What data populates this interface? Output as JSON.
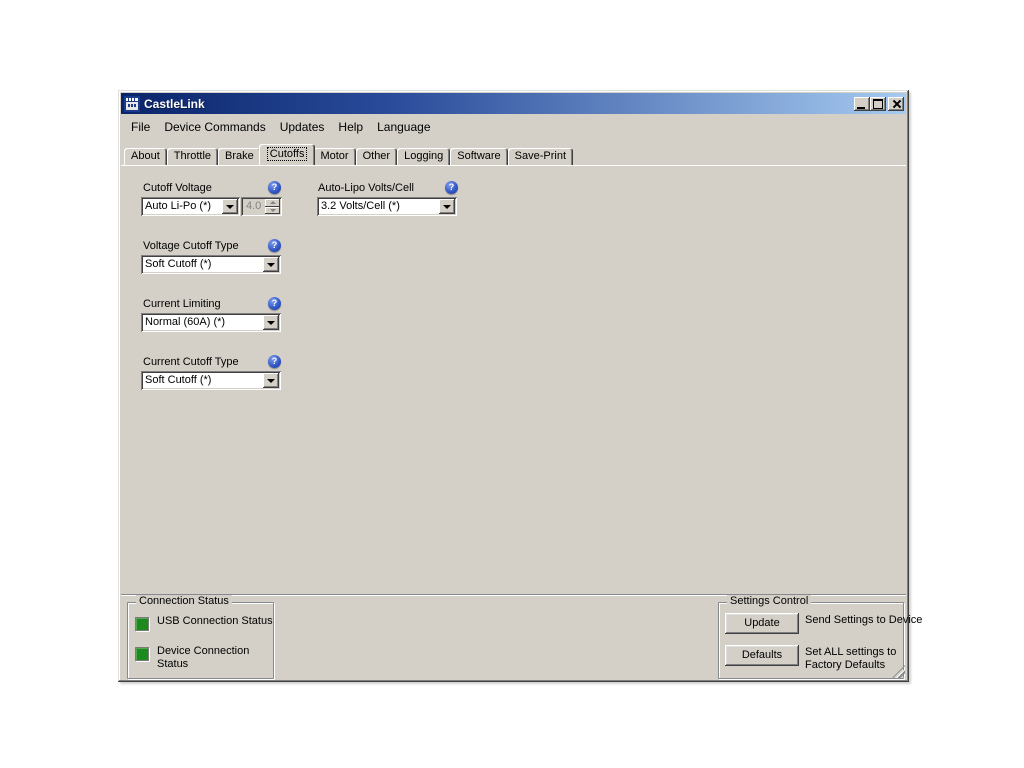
{
  "window": {
    "title": "CastleLink"
  },
  "menu": {
    "items": [
      "File",
      "Device Commands",
      "Updates",
      "Help",
      "Language"
    ]
  },
  "tabs": {
    "items": [
      "About",
      "Throttle",
      "Brake",
      "Cutoffs",
      "Motor",
      "Other",
      "Logging",
      "Software",
      "Save-Print"
    ],
    "active": "Cutoffs"
  },
  "form": {
    "help_icon_glyph": "?",
    "cutoff_voltage": {
      "label": "Cutoff Voltage",
      "selected": "Auto Li-Po (*)",
      "spinner_value": "4.0"
    },
    "auto_lipo_volts": {
      "label": "Auto-Lipo Volts/Cell",
      "selected": "3.2 Volts/Cell (*)"
    },
    "voltage_cutoff_type": {
      "label": "Voltage Cutoff Type",
      "selected": "Soft Cutoff (*)"
    },
    "current_limiting": {
      "label": "Current Limiting",
      "selected": "Normal (60A) (*)"
    },
    "current_cutoff_type": {
      "label": "Current Cutoff Type",
      "selected": "Soft Cutoff (*)"
    }
  },
  "connection_status": {
    "title": "Connection Status",
    "items": [
      "USB Connection Status",
      "Device Connection Status"
    ]
  },
  "settings_control": {
    "title": "Settings Control",
    "update_button": "Update",
    "update_desc": "Send Settings to Device",
    "defaults_button": "Defaults",
    "defaults_desc": "Set ALL settings to Factory Defaults"
  },
  "colors": {
    "titlebar_gradient_left": "#0a246a",
    "titlebar_gradient_right": "#a6caf0",
    "window_face": "#d4d0c8",
    "led_green": "#1c8a1c",
    "help_icon_blue": "#2f55c4"
  }
}
